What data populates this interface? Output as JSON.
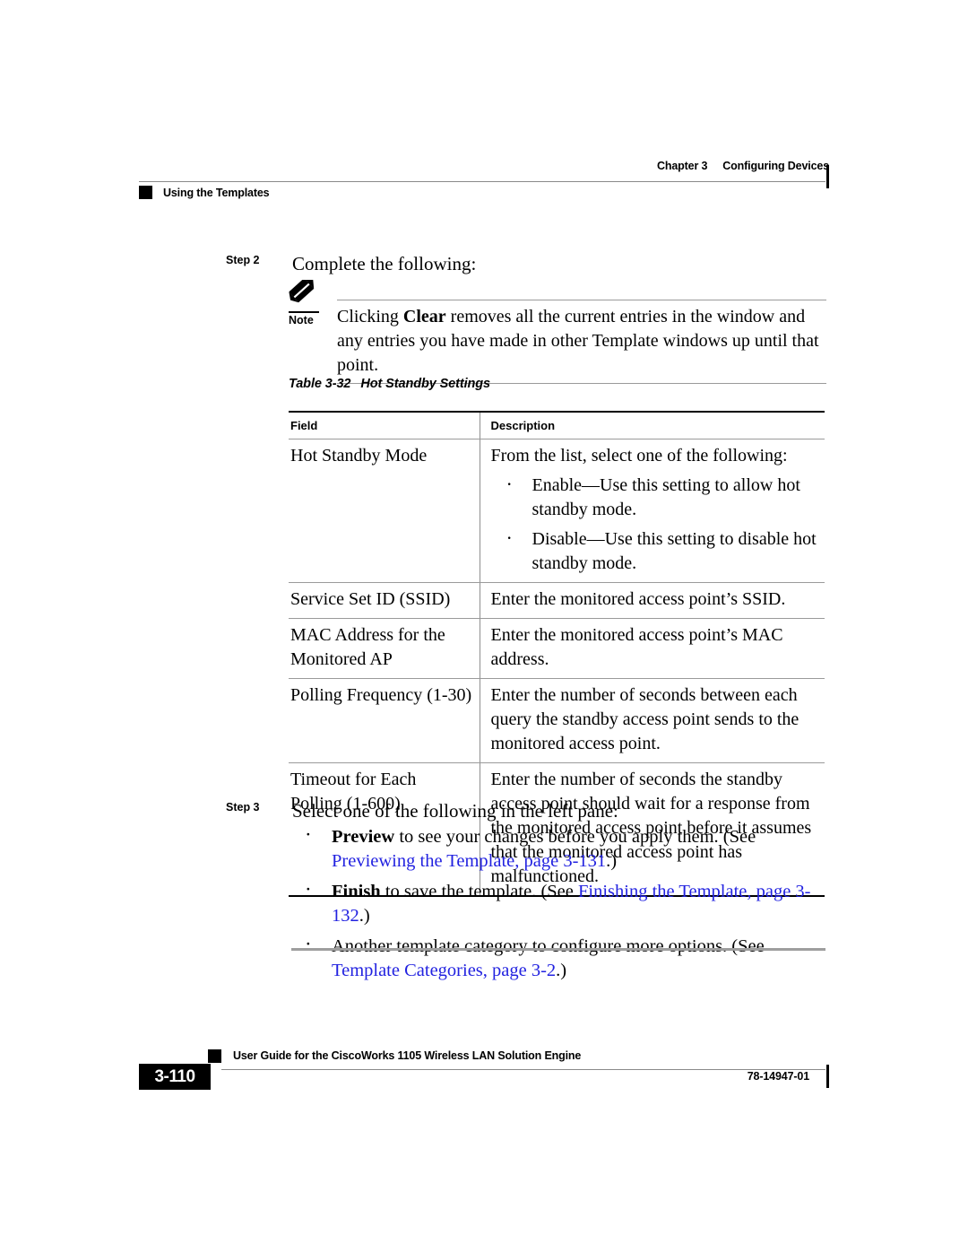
{
  "header": {
    "chapter": "Chapter 3",
    "chapter_title": "Configuring Devices",
    "section_title": "Using the Templates"
  },
  "step2": {
    "label": "Step 2",
    "text": "Complete the following:"
  },
  "note": {
    "label": "Note",
    "text_before_bold": "Clicking ",
    "bold_word": "Clear",
    "text_after_bold": " removes all the current entries in the window and any entries you have made in other Template windows up until that point."
  },
  "table": {
    "caption_number": "Table 3-32",
    "caption_title": "Hot Standby Settings",
    "columns": [
      "Field",
      "Description"
    ],
    "rows": [
      {
        "field": "Hot Standby Mode",
        "description_intro": "From the list, select one of the following:",
        "bullets": [
          "Enable—Use this setting to allow hot standby mode.",
          "Disable—Use this setting to disable hot standby mode."
        ]
      },
      {
        "field": "Service Set ID (SSID)",
        "description_intro": "Enter the monitored access point’s SSID.",
        "bullets": []
      },
      {
        "field": "MAC Address for the Monitored AP",
        "description_intro": "Enter the monitored access point’s MAC address.",
        "bullets": []
      },
      {
        "field": "Polling Frequency (1-30)",
        "description_intro": "Enter the number of seconds between each query the standby access point sends to the monitored access point.",
        "bullets": []
      },
      {
        "field": "Timeout for Each Polling (1-600)",
        "description_intro": "Enter the number of seconds the standby access point should wait for a response from the monitored access point before it assumes that the monitored access point has malfunctioned.",
        "bullets": []
      }
    ]
  },
  "step3": {
    "label": "Step 3",
    "text": "Select one of the following in the left pane:",
    "bullets": [
      {
        "bold": "Preview",
        "text": " to see your changes before you apply them. (See ",
        "link": "Previewing the Template, page 3-131",
        "tail": ".)"
      },
      {
        "bold": "Finish",
        "text": " to save the template. (See ",
        "link": "Finishing the Template, page 3-132",
        "tail": ".)"
      },
      {
        "bold": "",
        "text": "Another template category to configure more options. (See ",
        "link": "Template Categories, page 3-2",
        "tail": ".)"
      }
    ]
  },
  "footer": {
    "page_number": "3-110",
    "document_title": "User Guide for the CiscoWorks 1105 Wireless LAN Solution Engine",
    "document_number": "78-14947-01"
  },
  "colors": {
    "link": "#2222e0",
    "rule": "#9a9a9a",
    "black": "#000000"
  }
}
